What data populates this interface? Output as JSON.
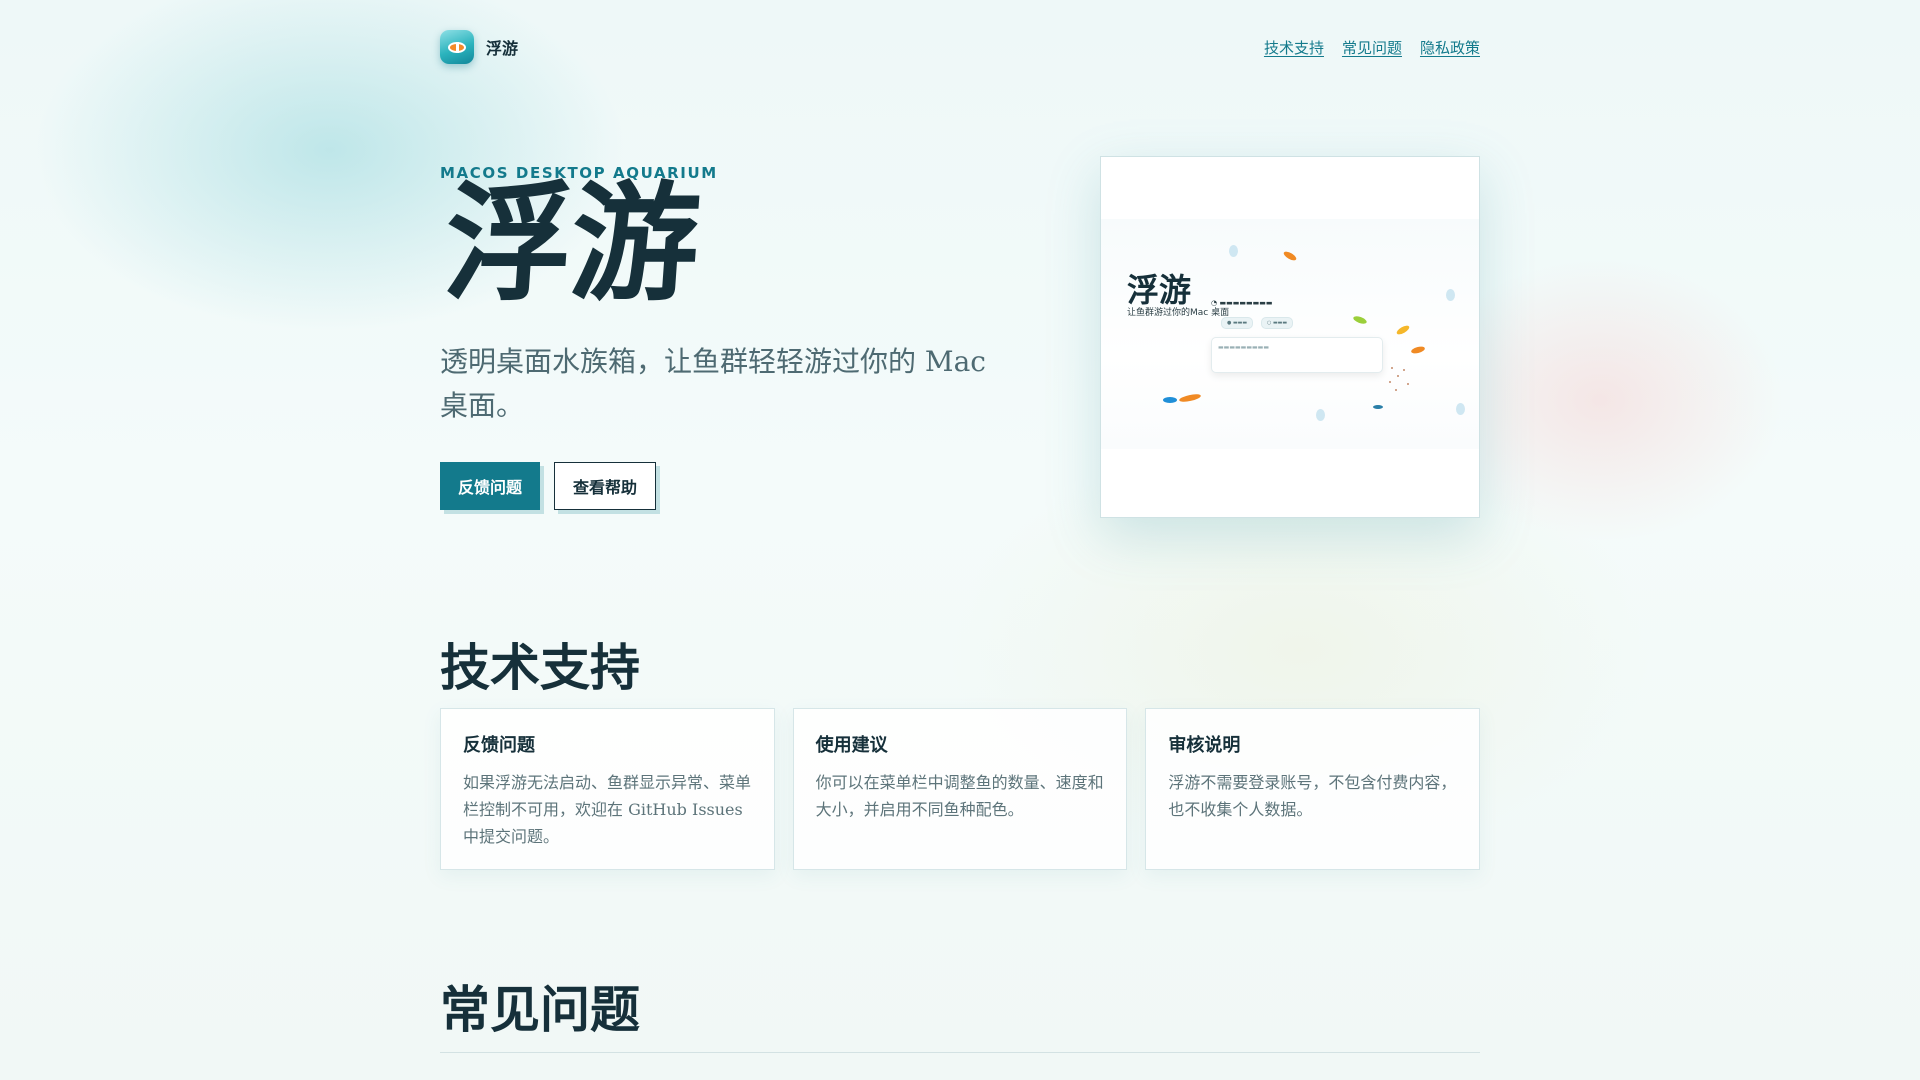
{
  "header": {
    "brand_name": "浮游",
    "nav": [
      {
        "label": "技术支持"
      },
      {
        "label": "常见问题"
      },
      {
        "label": "隐私政策"
      }
    ]
  },
  "hero": {
    "eyebrow": "MACOS DESKTOP AQUARIUM",
    "title": "浮游",
    "subtitle": "透明桌面水族箱，让鱼群轻轻游过你的 Mac 桌面。",
    "primary_button": "反馈问题",
    "secondary_button": "查看帮助"
  },
  "preview": {
    "title": "浮游",
    "subtitle": "让鱼群游过你的Mac 桌面"
  },
  "support": {
    "heading": "技术支持",
    "cards": [
      {
        "title": "反馈问题",
        "body": "如果浮游无法启动、鱼群显示异常、菜单栏控制不可用，欢迎在 GitHub Issues 中提交问题。"
      },
      {
        "title": "使用建议",
        "body": "你可以在菜单栏中调整鱼的数量、速度和大小，并启用不同鱼种配色。"
      },
      {
        "title": "审核说明",
        "body": "浮游不需要登录账号，不包含付费内容，也不收集个人数据。"
      }
    ]
  },
  "faq": {
    "heading": "常见问题"
  },
  "colors": {
    "accent": "#137a8c",
    "text": "#16303a",
    "muted": "#5d747a"
  }
}
